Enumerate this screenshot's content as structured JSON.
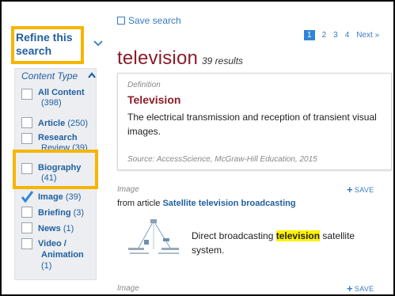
{
  "save_search": {
    "label": "Save search"
  },
  "pagination": {
    "current": "1",
    "pages": [
      "2",
      "3",
      "4"
    ],
    "next": "Next »"
  },
  "sidebar": {
    "refine_title_line1": "Refine this",
    "refine_title_line2": "search",
    "facet_title": "Content Type",
    "items": [
      {
        "label": "All Content",
        "count": "(398)",
        "checked": false
      },
      {
        "label": "Article",
        "count": "(250)",
        "checked": false
      },
      {
        "label": "Research",
        "count": "Review (39)",
        "checked": false
      },
      {
        "label": "Biography",
        "count": "(41)",
        "checked": false
      },
      {
        "label": "Image",
        "count": "(39)",
        "checked": true
      },
      {
        "label": "Briefing",
        "count": "(3)",
        "checked": false
      },
      {
        "label": "News",
        "count": "(1)",
        "checked": false
      },
      {
        "label": "Video /",
        "label2": "Animation",
        "count": "(1)",
        "checked": false
      }
    ]
  },
  "results": {
    "query": "television",
    "count_text": "39 results"
  },
  "definition": {
    "kind": "Definition",
    "term": "Television",
    "text": "The electrical transmission and reception of transient visual images.",
    "source": "Source: AccessScience, McGraw-Hill Education, 2015"
  },
  "result_items": [
    {
      "kind": "Image",
      "save_label": "SAVE",
      "from_prefix": "from article",
      "article_title": "Satellite television broadcasting",
      "caption_before": "Direct broadcasting ",
      "caption_highlight": "television",
      "caption_after": " satellite system."
    },
    {
      "kind": "Image",
      "save_label": "SAVE"
    }
  ],
  "colors": {
    "accent": "#1f5f9e",
    "title": "#8b1c2a",
    "highlight_box": "#f7b500",
    "check": "#2f85d8"
  }
}
